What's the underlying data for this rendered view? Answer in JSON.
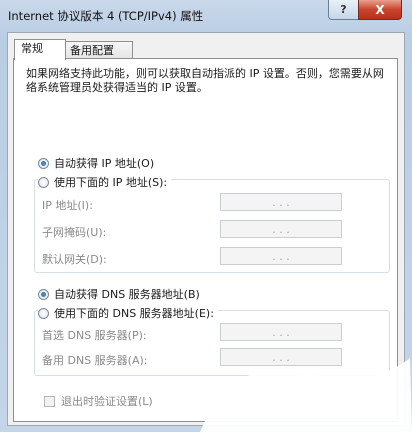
{
  "window": {
    "title": "Internet 协议版本 4 (TCP/IPv4) 属性",
    "help_label": "?",
    "close_label": "X"
  },
  "tabs": [
    {
      "label": "常规",
      "active": true
    },
    {
      "label": "备用配置",
      "active": false
    }
  ],
  "description": "如果网络支持此功能，则可以获取自动指派的 IP 设置。否则，您需要从网络系统管理员处获得适当的 IP 设置。",
  "ip_section": {
    "auto_label": "自动获得 IP 地址(O)",
    "auto_selected": true,
    "manual_label": "使用下面的 IP 地址(S):",
    "fields": [
      {
        "label": "IP 地址(I):",
        "value": ". . ."
      },
      {
        "label": "子网掩码(U):",
        "value": ". . ."
      },
      {
        "label": "默认网关(D):",
        "value": ". . ."
      }
    ]
  },
  "dns_section": {
    "auto_label": "自动获得 DNS 服务器地址(B)",
    "auto_selected": true,
    "manual_label": "使用下面的 DNS 服务器地址(E):",
    "fields": [
      {
        "label": "首选 DNS 服务器(P):",
        "value": ". . ."
      },
      {
        "label": "备用 DNS 服务器(A):",
        "value": ". . ."
      }
    ]
  },
  "validate_on_exit_label": "退出时验证设置(L)",
  "validate_on_exit_checked": false
}
